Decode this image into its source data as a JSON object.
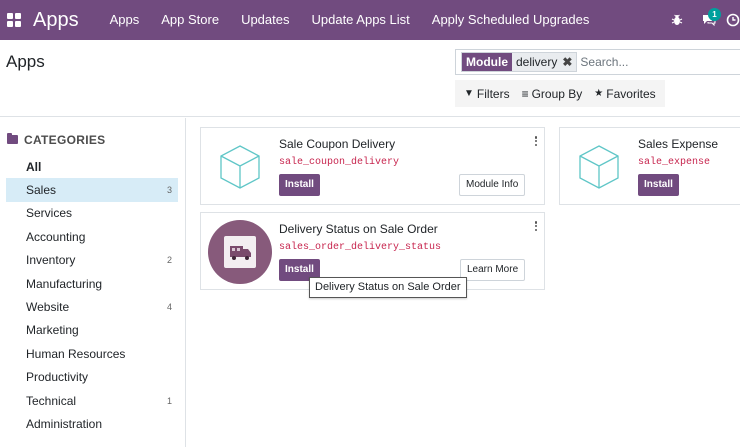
{
  "navbar": {
    "brand": "Apps",
    "menu": [
      "Apps",
      "App Store",
      "Updates",
      "Update Apps List",
      "Apply Scheduled Upgrades"
    ],
    "chat_count": "1",
    "color": "#714b7f"
  },
  "control_panel": {
    "breadcrumb": "Apps",
    "search": {
      "facet_label": "Module",
      "facet_value": "delivery",
      "placeholder": "Search..."
    },
    "filters_label": "Filters",
    "groupby_label": "Group By",
    "favorites_label": "Favorites"
  },
  "sidebar": {
    "header": "CATEGORIES",
    "items": [
      {
        "label": "All",
        "count": ""
      },
      {
        "label": "Sales",
        "count": "3"
      },
      {
        "label": "Services",
        "count": ""
      },
      {
        "label": "Accounting",
        "count": ""
      },
      {
        "label": "Inventory",
        "count": "2"
      },
      {
        "label": "Manufacturing",
        "count": ""
      },
      {
        "label": "Website",
        "count": "4"
      },
      {
        "label": "Marketing",
        "count": ""
      },
      {
        "label": "Human Resources",
        "count": ""
      },
      {
        "label": "Productivity",
        "count": ""
      },
      {
        "label": "Technical",
        "count": "1"
      },
      {
        "label": "Administration",
        "count": ""
      }
    ]
  },
  "apps": [
    {
      "title": "Sale Coupon Delivery",
      "technical_name": "sale_coupon_delivery",
      "install_label": "Install",
      "secondary_label": "Module Info",
      "icon": "cube-icon"
    },
    {
      "title": "Sales Expense",
      "technical_name": "sale_expense",
      "install_label": "Install",
      "secondary_label": "",
      "icon": "cube-icon"
    },
    {
      "title": "Delivery Status on Sale Order",
      "technical_name": "sales_order_delivery_status",
      "install_label": "Install",
      "secondary_label": "Learn More",
      "icon": "delivery-truck-icon"
    }
  ],
  "tooltip": "Delivery Status on Sale Order"
}
